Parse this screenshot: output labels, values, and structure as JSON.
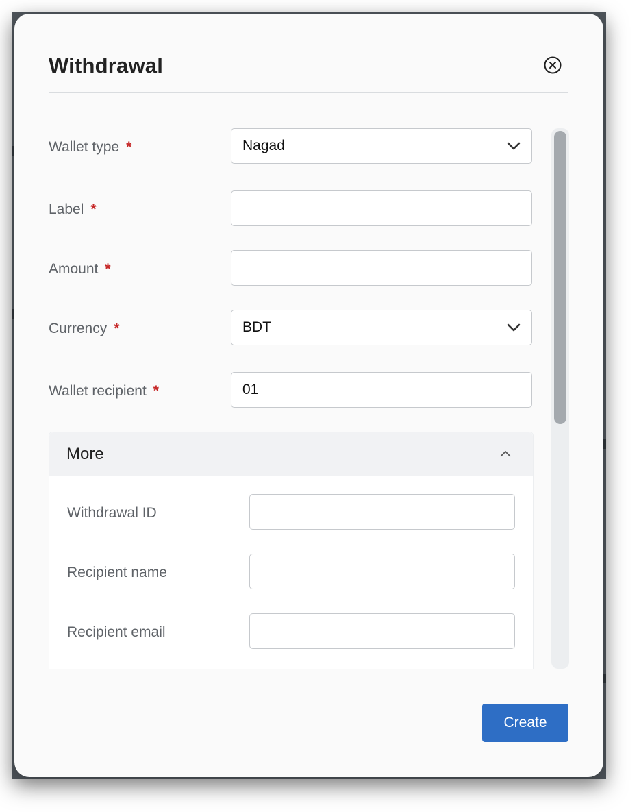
{
  "dialog": {
    "title": "Withdrawal",
    "close_icon": "close-circle-icon"
  },
  "fields": {
    "wallet_type": {
      "label": "Wallet type",
      "required_mark": "*",
      "value": "Nagad"
    },
    "label": {
      "label": "Label",
      "required_mark": "*",
      "value": ""
    },
    "amount": {
      "label": "Amount",
      "required_mark": "*",
      "value": ""
    },
    "currency": {
      "label": "Currency",
      "required_mark": "*",
      "value": "BDT"
    },
    "wallet_recipient": {
      "label": "Wallet recipient",
      "required_mark": "*",
      "value": "01"
    }
  },
  "more": {
    "title": "More",
    "expanded": true,
    "fields": {
      "withdrawal_id": {
        "label": "Withdrawal ID",
        "value": ""
      },
      "recipient_name": {
        "label": "Recipient name",
        "value": ""
      },
      "recipient_email": {
        "label": "Recipient email",
        "value": ""
      }
    }
  },
  "actions": {
    "create_label": "Create"
  },
  "colors": {
    "primary": "#2e6ec5",
    "required": "#c62828",
    "overlay": "#4d5359"
  }
}
